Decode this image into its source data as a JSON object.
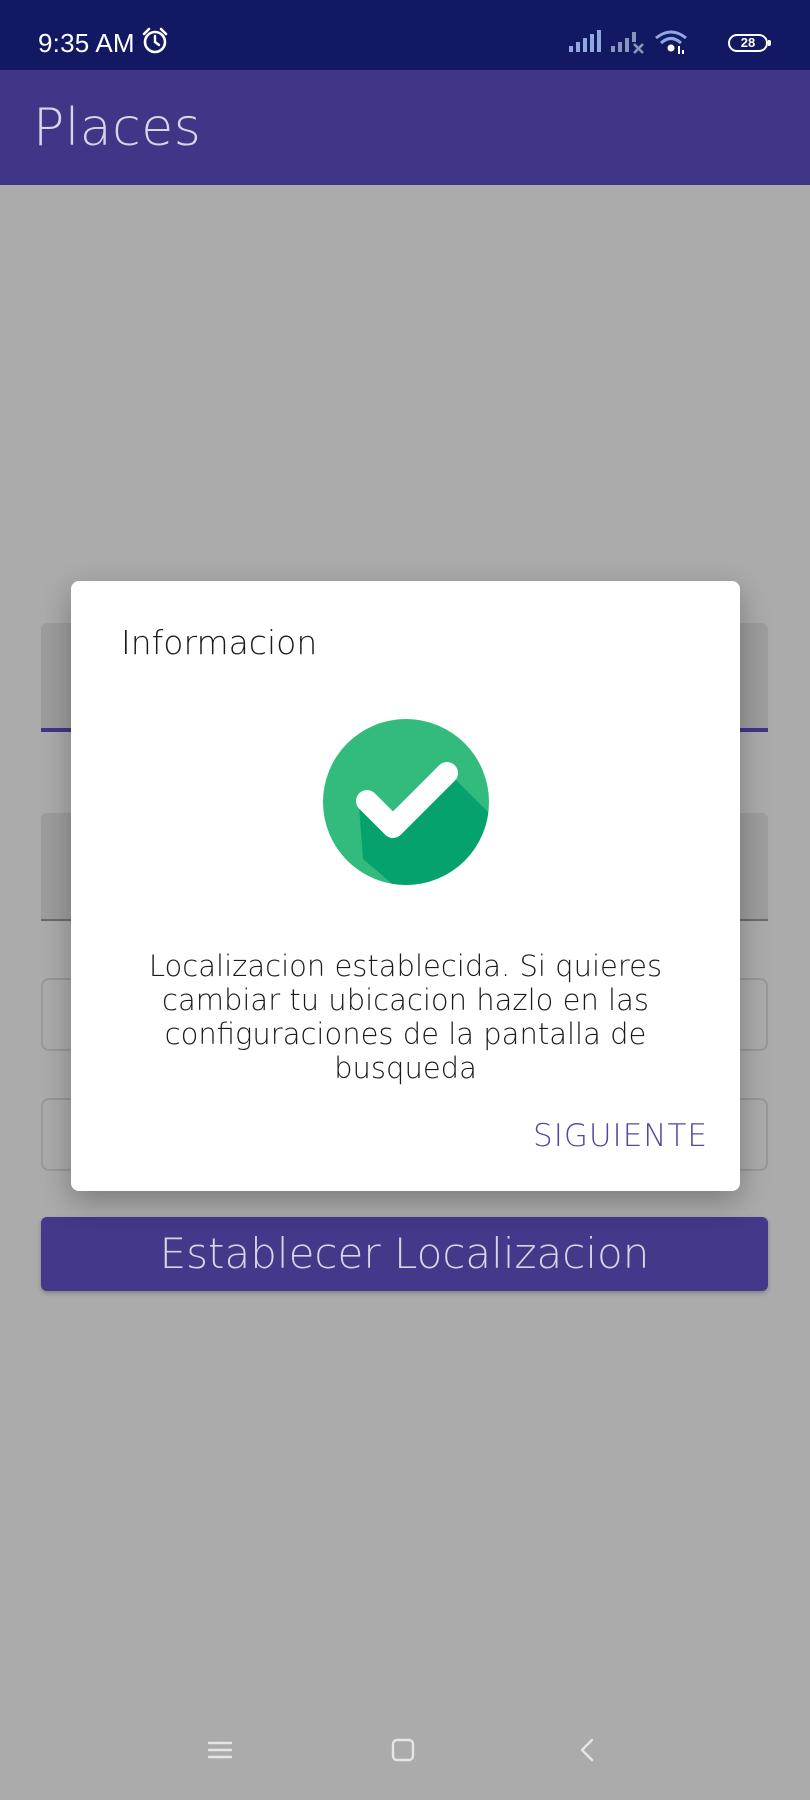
{
  "status_bar": {
    "time": "9:35 AM",
    "battery": "28",
    "icons": [
      "alarm-icon",
      "signal-icon",
      "signal-off-icon",
      "wifi-icon",
      "battery-icon"
    ]
  },
  "app_bar": {
    "title": "Places",
    "color": "#403687"
  },
  "form": {
    "submit_label": "Establecer Localizacion"
  },
  "dialog": {
    "title": "Informacion",
    "icon": "check-circle-icon",
    "message": "Localizacion establecida. Si quieres cambiar tu ubicacion hazlo en las configuraciones de la pantalla de busqueda",
    "action_label": "SIGUIENTE",
    "icon_color": "#33bb7d",
    "action_color": "#5248a0"
  },
  "nav_bar": {
    "icons": [
      "menu-icon",
      "home-icon",
      "back-icon"
    ]
  }
}
